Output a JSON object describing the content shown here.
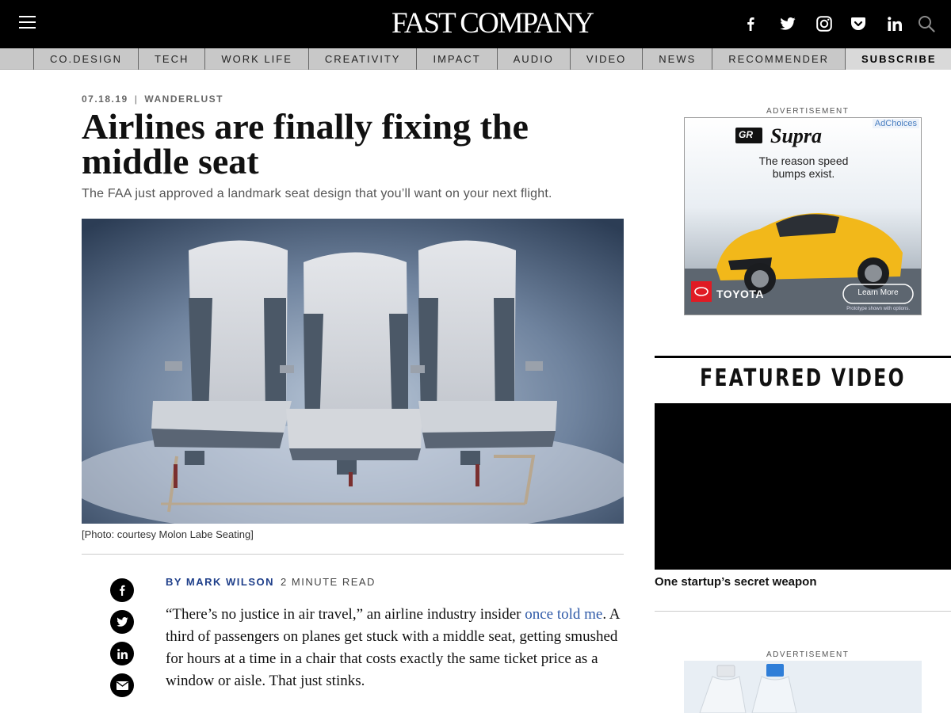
{
  "header": {
    "logo": "FAST COMPANY",
    "social_icons": [
      "facebook-icon",
      "twitter-icon",
      "instagram-icon",
      "pocket-icon",
      "linkedin-icon",
      "search-icon"
    ]
  },
  "nav": {
    "items": [
      "CO.DESIGN",
      "TECH",
      "WORK LIFE",
      "CREATIVITY",
      "IMPACT",
      "AUDIO",
      "VIDEO",
      "NEWS",
      "RECOMMENDER",
      "SUBSCRIBE"
    ]
  },
  "article": {
    "date": "07.18.19",
    "category": "WANDERLUST",
    "title": "Airlines are finally fixing the middle seat",
    "dek": "The FAA just approved a landmark seat design that you’ll want on your next flight.",
    "caption": "[Photo: courtesy Molon Labe Seating]",
    "byline_author": "BY MARK WILSON",
    "read_time": "2 MINUTE READ",
    "body_before_link": "“There’s no justice in air travel,” an airline industry insider ",
    "body_link": "once told me",
    "body_after_link": ". A third of passengers on planes get stuck with a middle seat, getting smushed for hours at a time in a chair that costs exactly the same ticket price as a window or aisle. That just stinks."
  },
  "share_icons": [
    "facebook-icon",
    "twitter-icon",
    "linkedin-icon",
    "email-icon"
  ],
  "rail": {
    "ad_label": "ADVERTISEMENT",
    "ad": {
      "adchoices": "AdChoices",
      "brand_mark": "GR",
      "model": "Supra",
      "tagline_1": "The reason speed",
      "tagline_2": "bumps exist.",
      "brand": "TOYOTA",
      "cta": "Learn More",
      "disclaimer": "Prototype shown with options."
    },
    "featured_video_heading": "FEATURED VIDEO",
    "video_title": "One startup’s secret weapon",
    "ad2_label": "ADVERTISEMENT"
  },
  "colors": {
    "header_bg": "#000000",
    "nav_bg": "#c8c8c8",
    "link_blue": "#2f5aa8",
    "author_blue": "#1f3f8a",
    "ad_car_yellow": "#f2b81a"
  }
}
